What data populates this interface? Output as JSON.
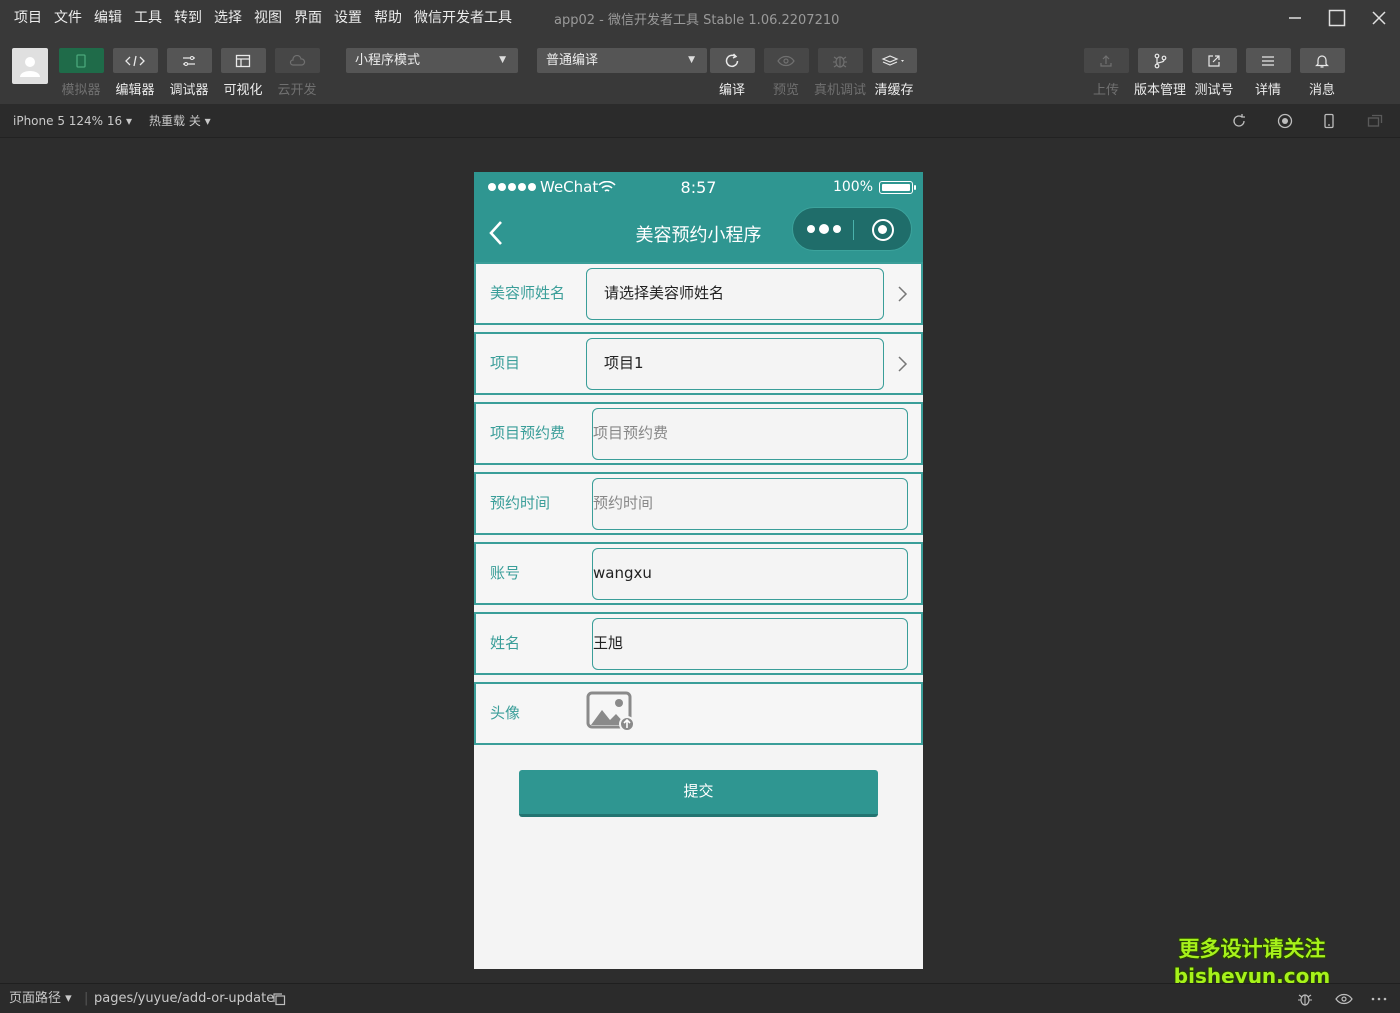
{
  "menu": [
    "项目",
    "文件",
    "编辑",
    "工具",
    "转到",
    "选择",
    "视图",
    "界面",
    "设置",
    "帮助",
    "微信开发者工具"
  ],
  "window": {
    "title": "app02 - 微信开发者工具 Stable 1.06.2207210"
  },
  "toolbar": {
    "left": [
      {
        "label": "模拟器",
        "icon": "phone-icon",
        "state": "active"
      },
      {
        "label": "编辑器",
        "icon": "code-icon",
        "state": "normal"
      },
      {
        "label": "调试器",
        "icon": "debug-icon",
        "state": "normal"
      },
      {
        "label": "可视化",
        "icon": "layout-icon",
        "state": "normal"
      },
      {
        "label": "云开发",
        "icon": "cloud-icon",
        "state": "disabled"
      }
    ],
    "mode_select": "小程序模式",
    "compile_select": "普通编译",
    "middle": [
      {
        "label": "编译",
        "icon": "refresh-icon",
        "state": "normal"
      },
      {
        "label": "预览",
        "icon": "eye-icon",
        "state": "disabled"
      },
      {
        "label": "真机调试",
        "icon": "bug-icon",
        "state": "disabled"
      },
      {
        "label": "清缓存",
        "icon": "layers-icon",
        "state": "normal"
      }
    ],
    "right": [
      {
        "label": "上传",
        "icon": "upload-icon",
        "state": "disabled"
      },
      {
        "label": "版本管理",
        "icon": "branch-icon",
        "state": "normal"
      },
      {
        "label": "测试号",
        "icon": "external-link-icon",
        "state": "normal"
      },
      {
        "label": "详情",
        "icon": "menu-icon",
        "state": "normal"
      },
      {
        "label": "消息",
        "icon": "bell-icon",
        "state": "normal"
      }
    ]
  },
  "subbar": {
    "device": "iPhone 5 124% 16",
    "hot_reload": "热重载 关"
  },
  "phone": {
    "status": {
      "carrier": "WeChat",
      "time": "8:57",
      "battery": "100%"
    },
    "nav_title": "美容预约小程序",
    "rows": [
      {
        "label": "美容师姓名",
        "value": "请选择美容师姓名",
        "kind": "picker",
        "placeholder": false
      },
      {
        "label": "项目",
        "value": "项目1",
        "kind": "picker",
        "placeholder": false
      },
      {
        "label": "项目预约费",
        "value": "项目预约费",
        "kind": "input",
        "placeholder": true
      },
      {
        "label": "预约时间",
        "value": "预约时间",
        "kind": "input",
        "placeholder": true
      },
      {
        "label": "账号",
        "value": "wangxu",
        "kind": "input",
        "placeholder": false
      },
      {
        "label": "姓名",
        "value": "王旭",
        "kind": "input",
        "placeholder": false
      },
      {
        "label": "头像",
        "value": "",
        "kind": "image",
        "placeholder": false
      }
    ],
    "submit_label": "提交"
  },
  "footer": {
    "path_label": "页面路径",
    "path": "pages/yuyue/add-or-update"
  },
  "watermark": {
    "line1": "更多设计请关注",
    "line2": "bisheyun.com"
  },
  "colors": {
    "accent": "#2f9691",
    "chrome": "#393939",
    "background": "#2d2d2d"
  }
}
